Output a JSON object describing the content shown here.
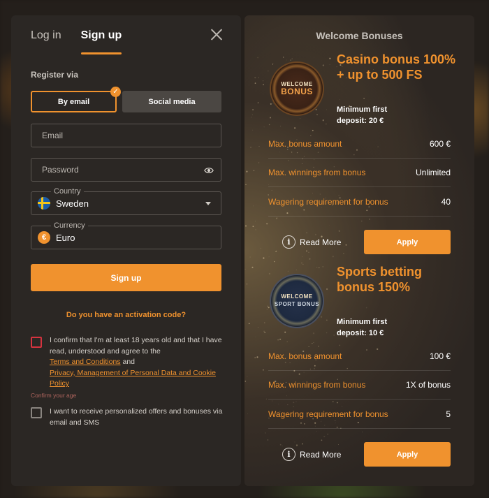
{
  "tabs": {
    "login": "Log in",
    "signup": "Sign up"
  },
  "form": {
    "register_via": "Register via",
    "by_email": "By email",
    "social_media": "Social media",
    "email_placeholder": "Email",
    "password_placeholder": "Password",
    "country_label": "Country",
    "country_value": "Sweden",
    "currency_label": "Currency",
    "currency_value": "Euro",
    "currency_symbol": "€",
    "signup_button": "Sign up",
    "activation_code": "Do you have an activation code?",
    "consent_age_text": "I confirm that I'm at least 18 years old and that I have read, understood and agree to the",
    "terms_link": "Terms and Conditions",
    "and_text": "and",
    "privacy_link": "Privacy, Management of Personal Data and Cookie Policy",
    "confirm_age_error": "Confirm your age",
    "consent_offers_text": "I want to receive personalized offers and bonuses via email and SMS"
  },
  "bonuses": {
    "title": "Welcome Bonuses",
    "casino": {
      "medal_top": "WELCOME",
      "medal_big": "BONUS",
      "title": "Casino bonus 100% + up to 500 FS",
      "min_deposit_label": "Minimum first",
      "min_deposit_value": "deposit: 20 €",
      "rows": [
        {
          "k": "Max. bonus amount",
          "v": "600 €"
        },
        {
          "k": "Max. winnings from bonus",
          "v": "Unlimited"
        },
        {
          "k": "Wagering requirement for bonus",
          "v": "40"
        }
      ],
      "read_more": "Read More",
      "apply": "Apply"
    },
    "sports": {
      "medal_top": "WELCOME",
      "medal_big": "SPORT BONUS",
      "title": "Sports betting bonus 150%",
      "min_deposit_label": "Minimum first",
      "min_deposit_value": "deposit: 10 €",
      "rows": [
        {
          "k": "Max. bonus amount",
          "v": "100 €"
        },
        {
          "k": "Max. winnings from bonus",
          "v": "1X of bonus"
        },
        {
          "k": "Wagering requirement for bonus",
          "v": "5"
        }
      ],
      "read_more": "Read More",
      "apply": "Apply"
    }
  },
  "colors": {
    "accent": "#f0922e",
    "panel": "#2b2724",
    "error": "#d6333f"
  }
}
